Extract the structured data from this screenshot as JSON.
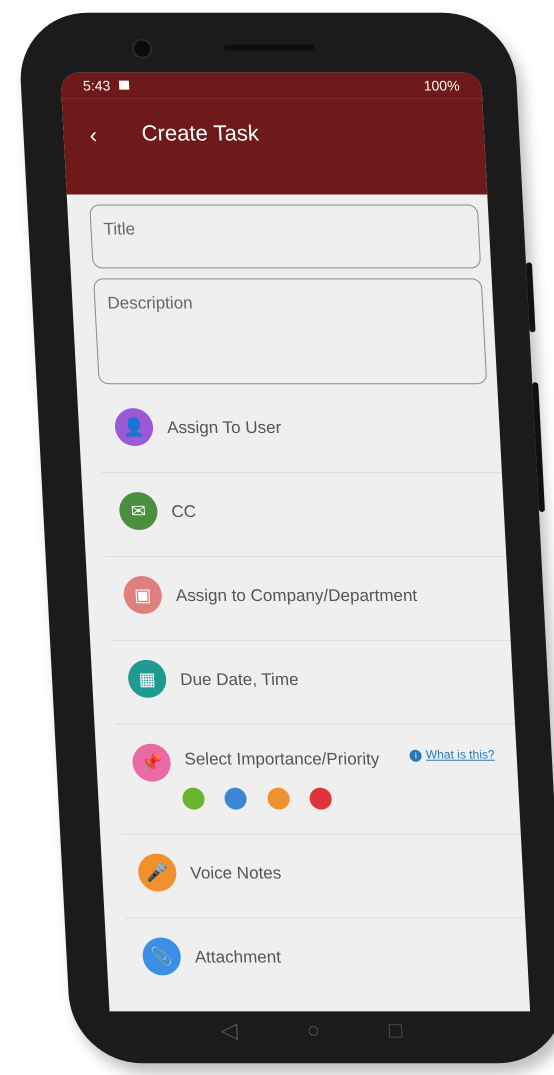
{
  "status": {
    "time": "5:43",
    "battery": "100%"
  },
  "appbar": {
    "back_label": "‹",
    "title": "Create Task"
  },
  "form": {
    "title_placeholder": "Title",
    "description_placeholder": "Description"
  },
  "rows": [
    {
      "label": "Assign To User",
      "icon": "person-icon",
      "color": "#9b59d6"
    },
    {
      "label": "CC",
      "icon": "mail-icon",
      "color": "#4a8f3d"
    },
    {
      "label": "Assign to Company/Department",
      "icon": "briefcase-icon",
      "color": "#e07f7f"
    },
    {
      "label": "Due Date, Time",
      "icon": "calendar-icon",
      "color": "#1f9a91"
    },
    {
      "label": "Select Importance/Priority",
      "icon": "pin-icon",
      "color": "#ea6aa6"
    },
    {
      "label": "Voice Notes",
      "icon": "mic-icon",
      "color": "#f0912d"
    },
    {
      "label": "Attachment",
      "icon": "paperclip-icon",
      "color": "#3b8fe4"
    }
  ],
  "priority": {
    "help_link": "What is this?",
    "colors": [
      "#6bb42f",
      "#3d86d6",
      "#f0902e",
      "#e0333b"
    ]
  },
  "nav": {
    "back": "◁",
    "home": "○",
    "recent": "□"
  }
}
